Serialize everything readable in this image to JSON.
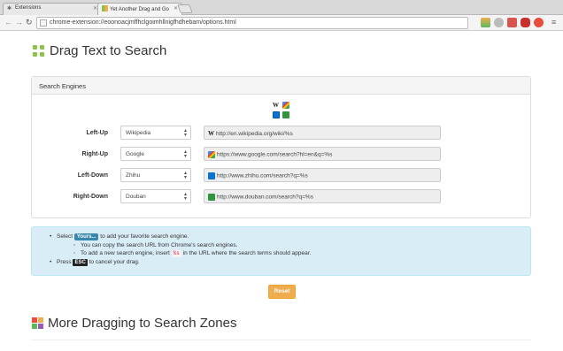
{
  "tabs": [
    {
      "label": "Extensions",
      "active": false
    },
    {
      "label": "Yet Another Drag and Go",
      "active": true
    }
  ],
  "address_bar": {
    "url": "chrome-extension://eoonoacjmffhclgoimhllnigfhdhebam/options.html"
  },
  "page": {
    "title": "Drag Text to Search"
  },
  "search_engines": {
    "heading": "Search Engines",
    "rows": [
      {
        "label": "Left-Up",
        "engine": "Wikipedia",
        "url": "http://en.wikipedia.org/wiki/%s",
        "icon": "wikipedia-icon"
      },
      {
        "label": "Right-Up",
        "engine": "Google",
        "url": "https://www.google.com/search?hl=en&q=%s",
        "icon": "google-icon"
      },
      {
        "label": "Left-Down",
        "engine": "Zhihu",
        "url": "http://www.zhihu.com/search?q=%s",
        "icon": "zhihu-icon"
      },
      {
        "label": "Right-Down",
        "engine": "Douban",
        "url": "http://www.douban.com/search?q=%s",
        "icon": "douban-icon"
      }
    ]
  },
  "help": {
    "select_prefix": "Select",
    "yours_tag": "Yours...",
    "select_suffix": "to add your favorite search engine.",
    "copy_text": "You can copy the search URL from Chrome's search engines.",
    "insert_prefix": "To add a new search engine, insert",
    "insert_tag": "%s",
    "insert_suffix": "in the URL where the search terms should appear.",
    "press_prefix": "Press",
    "esc_tag": "ESC",
    "press_suffix": "to cancel your drag."
  },
  "reset_label": "Reset",
  "section2": {
    "title": "More Dragging to Search Zones"
  },
  "colors": {
    "accent_green": "#8bc34a",
    "info_bg": "#d9edf7",
    "reset_orange": "#f0ad4e",
    "tag_blue": "#3a87ad"
  }
}
